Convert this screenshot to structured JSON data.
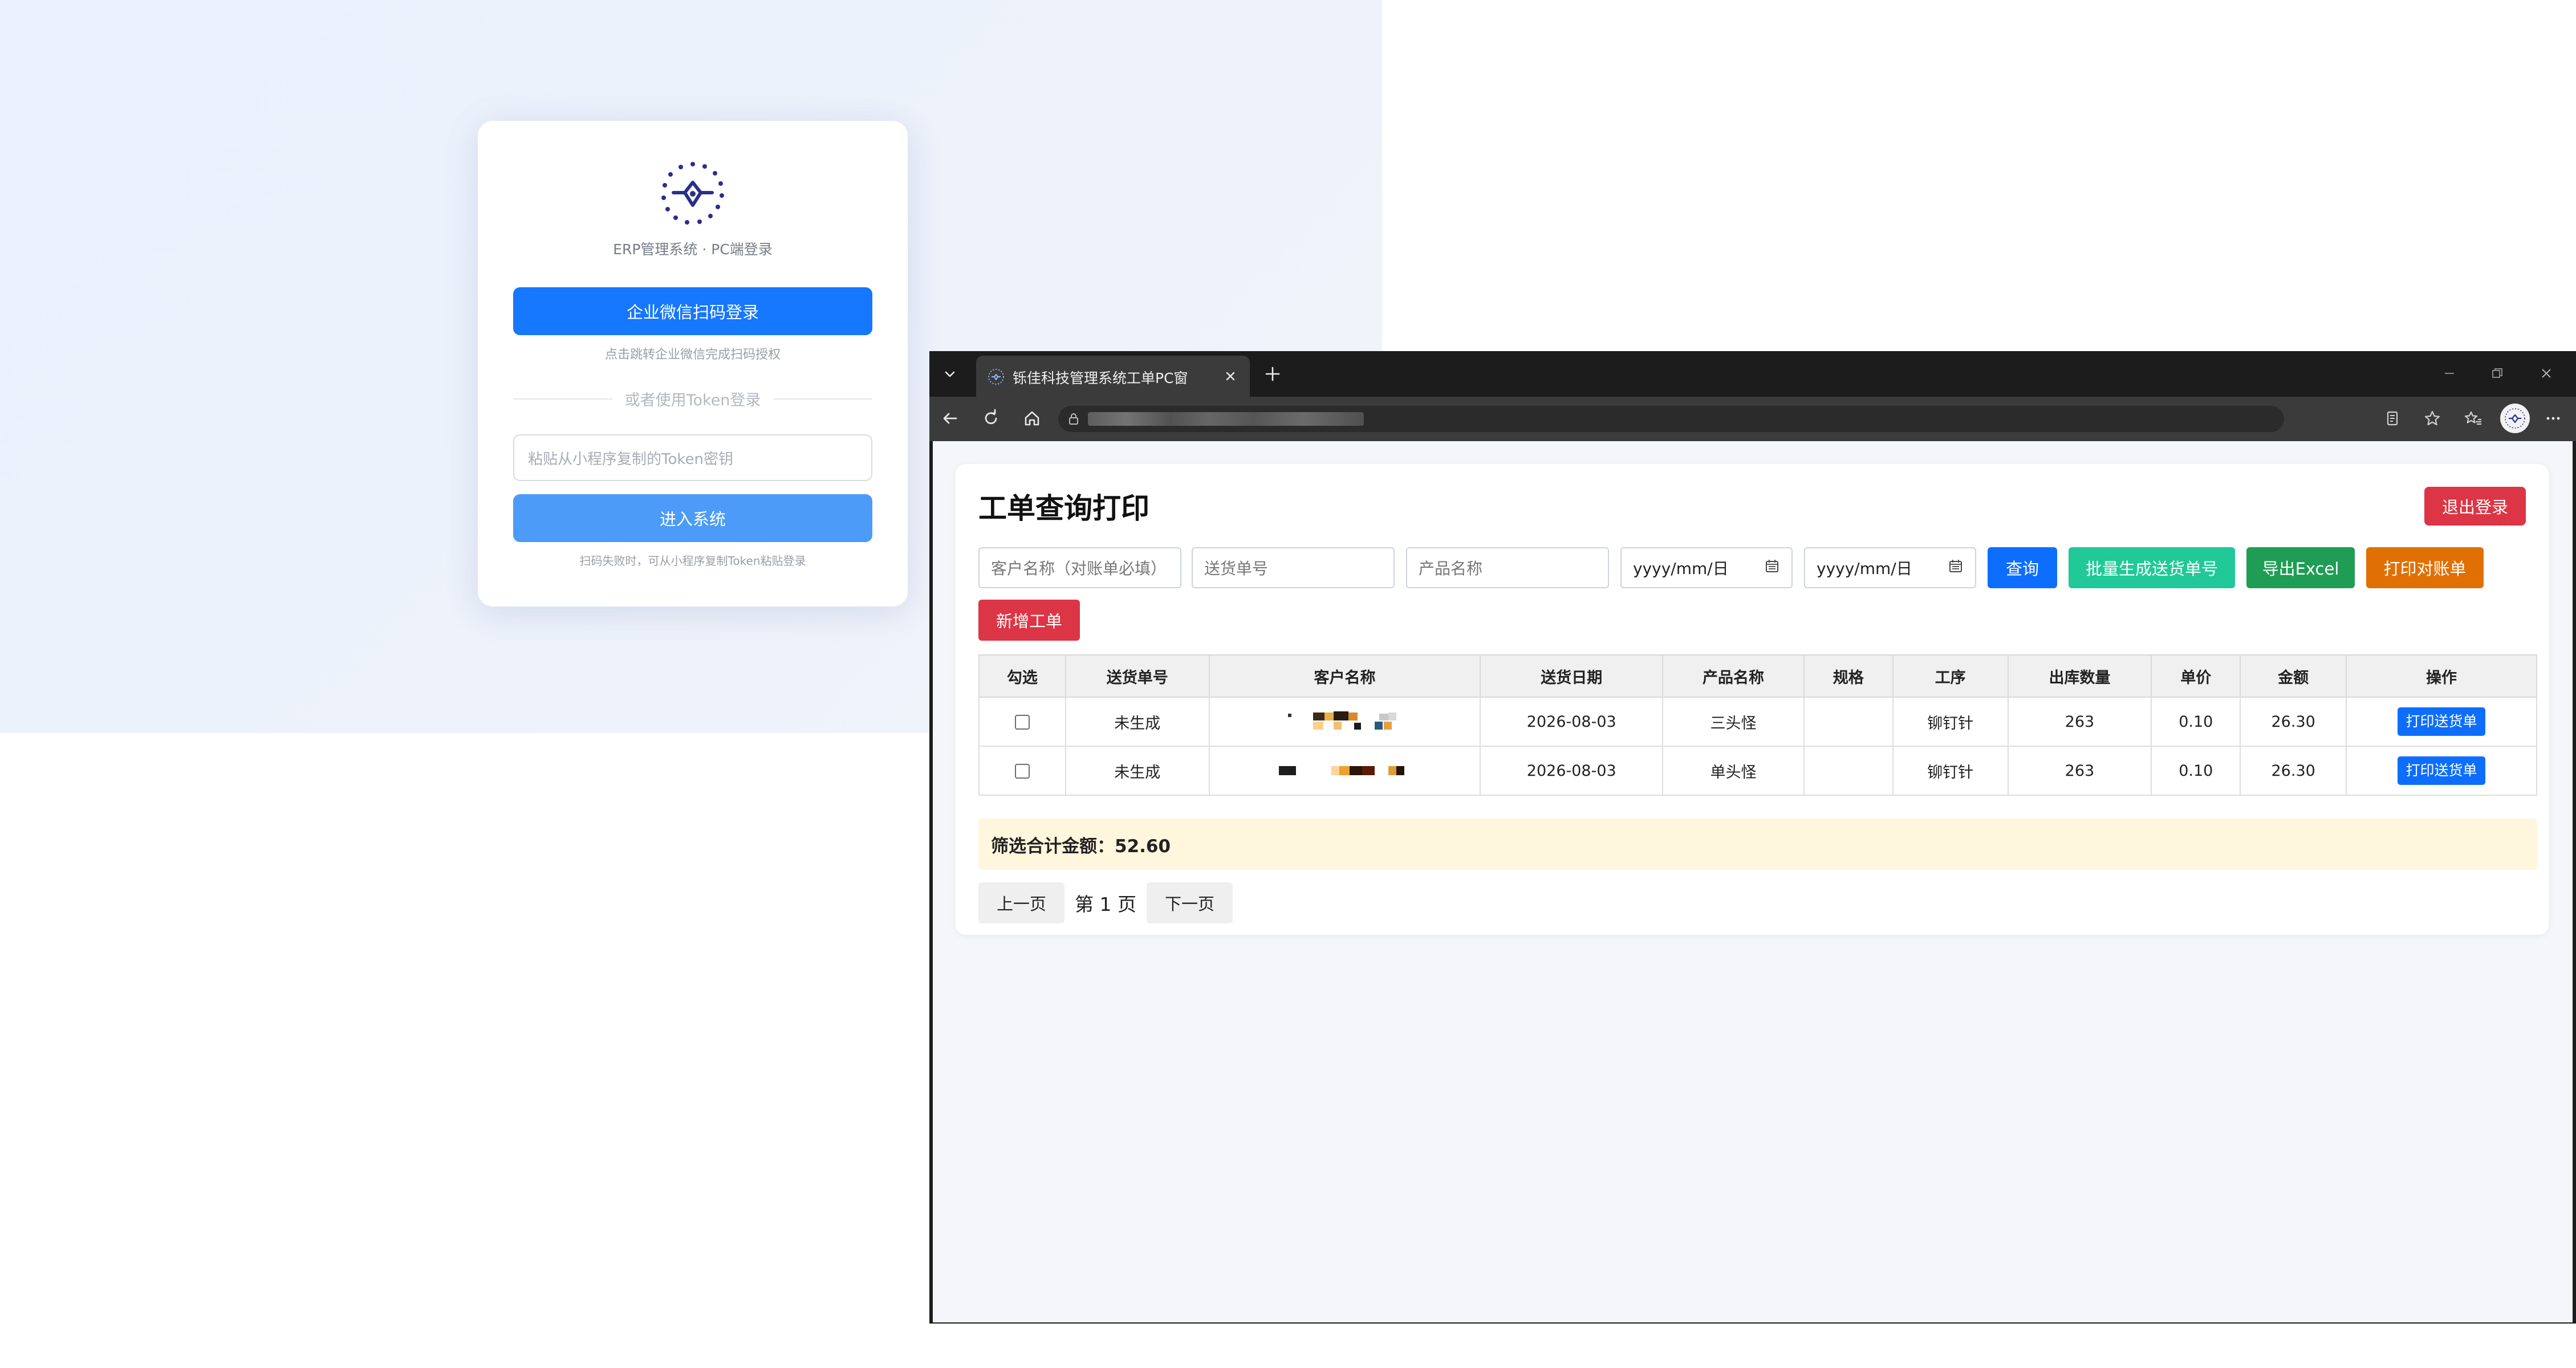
{
  "login": {
    "subtitle": "ERP管理系统 · PC端登录",
    "wecom_button": "企业微信扫码登录",
    "wecom_hint": "点击跳转企业微信完成扫码授权",
    "divider_text": "或者使用Token登录",
    "token_placeholder": "粘贴从小程序复制的Token密钥",
    "enter_button": "进入系统",
    "fallback_hint": "扫码失败时，可从小程序复制Token粘贴登录",
    "accent_color": "#1677ff"
  },
  "browser": {
    "tab_title": "铄佳科技管理系统工单PC窗",
    "icons": {
      "tab_list": "chevron-down-icon",
      "close_tab": "close-icon",
      "new_tab": "plus-icon",
      "back": "arrow-left-icon",
      "reload": "reload-icon",
      "home": "home-icon",
      "site_info": "lock-icon",
      "reading_mode": "reading-mode-icon",
      "favorite": "star-icon",
      "favorites_list": "favorites-icon",
      "profile": "profile-avatar",
      "menu": "more-icon"
    }
  },
  "page": {
    "title": "工单查询打印",
    "logout_button": "退出登录",
    "filters": {
      "customer_placeholder": "客户名称（对账单必填）",
      "delivery_no_placeholder": "送货单号",
      "product_placeholder": "产品名称",
      "date_from": "yyyy/mm/日",
      "date_to": "yyyy/mm/日"
    },
    "buttons": {
      "query": "查询",
      "batch_generate": "批量生成送货单号",
      "export_excel": "导出Excel",
      "print_statement": "打印对账单",
      "new_order": "新增工单"
    },
    "table": {
      "columns": [
        "勾选",
        "送货单号",
        "客户名称",
        "送货日期",
        "产品名称",
        "规格",
        "工序",
        "出库数量",
        "单价",
        "金额",
        "操作"
      ],
      "rows": [
        {
          "delivery_no": "未生成",
          "customer": "",
          "date": "2026-08-03",
          "product": "三头怪",
          "spec": "",
          "process": "铆钉针",
          "quantity": "263",
          "unit_price": "0.10",
          "amount": "26.30",
          "action": "打印送货单"
        },
        {
          "delivery_no": "未生成",
          "customer": "",
          "date": "2026-08-03",
          "product": "单头怪",
          "spec": "",
          "process": "铆钉针",
          "quantity": "263",
          "unit_price": "0.10",
          "amount": "26.30",
          "action": "打印送货单"
        }
      ]
    },
    "summary": "筛选合计金额：52.60",
    "pagination": {
      "prev": "上一页",
      "current": "第 1 页",
      "next": "下一页"
    }
  },
  "colors": {
    "primary": "#0d6efd",
    "danger": "#dc3545",
    "teal": "#20c997",
    "success": "#1f9d55",
    "orange": "#e07004",
    "summary_bg": "#fff7dd"
  }
}
